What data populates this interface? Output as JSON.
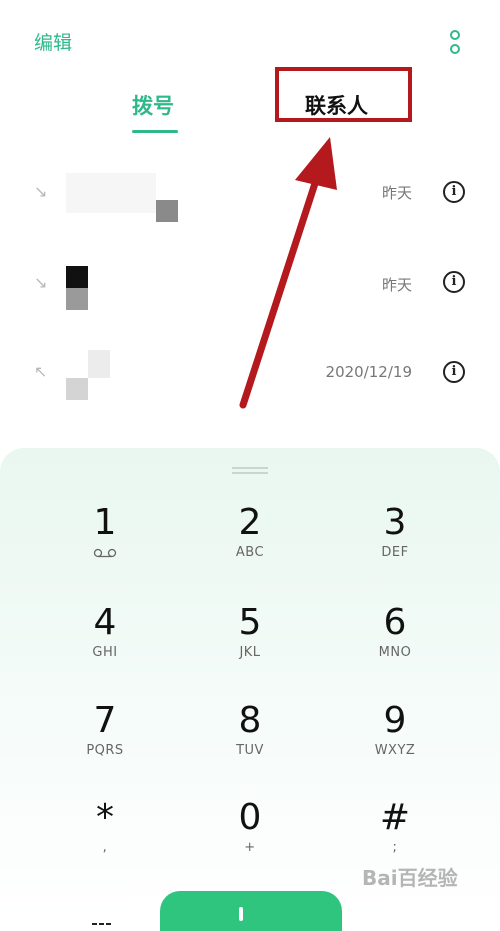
{
  "header": {
    "edit_label": "编辑"
  },
  "tabs": {
    "dial_label": "拨号",
    "contacts_label": "联系人"
  },
  "calls": [
    {
      "direction": "incoming",
      "date": "昨天"
    },
    {
      "direction": "incoming",
      "date": "昨天"
    },
    {
      "direction": "outgoing",
      "date": "2020/12/19"
    }
  ],
  "keypad": {
    "keys": [
      {
        "digit": "1",
        "letters": ""
      },
      {
        "digit": "2",
        "letters": "ABC"
      },
      {
        "digit": "3",
        "letters": "DEF"
      },
      {
        "digit": "4",
        "letters": "GHI"
      },
      {
        "digit": "5",
        "letters": "JKL"
      },
      {
        "digit": "6",
        "letters": "MNO"
      },
      {
        "digit": "7",
        "letters": "PQRS"
      },
      {
        "digit": "8",
        "letters": "TUV"
      },
      {
        "digit": "9",
        "letters": "WXYZ"
      },
      {
        "digit": "*",
        "letters": ","
      },
      {
        "digit": "0",
        "letters": "+"
      },
      {
        "digit": "#",
        "letters": ";"
      }
    ]
  },
  "colors": {
    "accent": "#2fb98a",
    "annotation": "#b3191d",
    "call_button": "#2fc57f"
  },
  "watermark": "Bai百经验"
}
